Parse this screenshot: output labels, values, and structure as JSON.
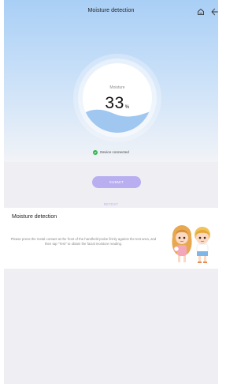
{
  "header": {
    "title": "Moisture detection"
  },
  "gauge": {
    "label": "Moisture",
    "value": "33",
    "unit": "%",
    "level_percent": 33
  },
  "status": {
    "text": "Device connected",
    "color": "#2eb34a"
  },
  "actions": {
    "submit_label": "SUBMIT",
    "retest_label": "RETEST",
    "accent": "#b8aef0"
  },
  "card": {
    "title": "Moisture detection",
    "description": "Please press the metal contact at the front of the handheld probe firmly against the test area, and then tap \"Test\" to obtain the facial moisture reading."
  },
  "icons": {
    "home": "home-icon",
    "back": "back-arrow-icon",
    "check": "check-icon"
  }
}
